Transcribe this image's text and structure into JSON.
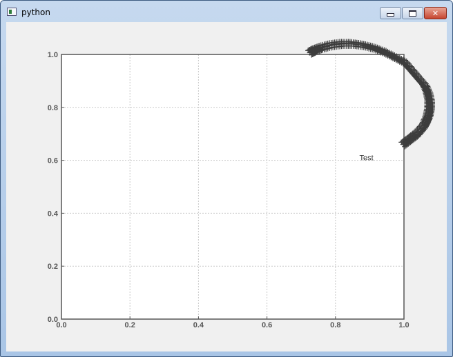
{
  "window": {
    "title": "python",
    "buttons": {
      "minimize": "",
      "maximize": "",
      "close": "✕"
    }
  },
  "colors": {
    "marker": "#3d3d3d",
    "grid": "#c8c8c8",
    "frame": "#555555"
  },
  "chart_data": {
    "type": "scatter",
    "title": "",
    "xlabel": "",
    "ylabel": "",
    "xlim": [
      0.0,
      1.0
    ],
    "ylim": [
      0.0,
      1.0
    ],
    "grid": true,
    "xticks": [
      "0.0",
      "0.2",
      "0.4",
      "0.6",
      "0.8",
      "1.0"
    ],
    "yticks": [
      "0.0",
      "0.2",
      "0.4",
      "0.6",
      "0.8",
      "1.0"
    ],
    "marker": "+",
    "annotations": [
      {
        "text": "Test",
        "x": 0.87,
        "y": 0.6
      }
    ],
    "series": [
      {
        "x": [
          1.0,
          1.02,
          1.04,
          1.06,
          1.07,
          1.075,
          1.075,
          1.07,
          1.06,
          1.04,
          1.02,
          1.0,
          0.97,
          0.94,
          0.91,
          0.88,
          0.85,
          0.82,
          0.79,
          0.76,
          0.74,
          0.725
        ],
        "y": [
          0.66,
          0.68,
          0.7,
          0.73,
          0.76,
          0.79,
          0.82,
          0.85,
          0.88,
          0.91,
          0.94,
          0.97,
          0.99,
          1.01,
          1.025,
          1.035,
          1.04,
          1.04,
          1.035,
          1.025,
          1.015,
          1.005
        ]
      }
    ]
  }
}
